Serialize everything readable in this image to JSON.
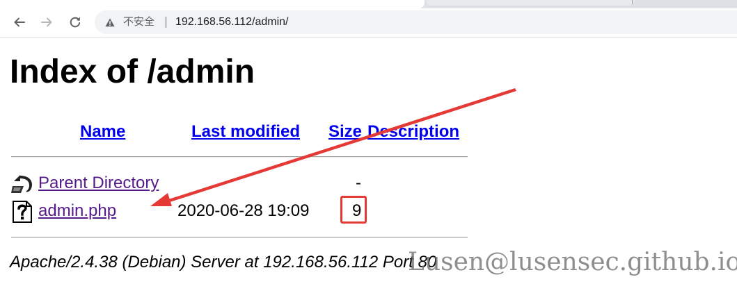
{
  "browser": {
    "security_label": "不安全",
    "url": "192.168.56.112/admin/",
    "icons": {
      "back": "arrow-left-icon",
      "forward": "arrow-right-icon",
      "reload": "reload-icon",
      "security": "warning-triangle-icon"
    }
  },
  "page": {
    "title": "Index of /admin",
    "columns": {
      "name": "Name",
      "last_modified": "Last modified",
      "size": "Size",
      "description": "Description"
    },
    "rows": [
      {
        "icon": "back-arrow-icon",
        "name": "Parent Directory",
        "last_modified": "",
        "size": "-",
        "description": ""
      },
      {
        "icon": "unknown-file-icon",
        "name": "admin.php",
        "last_modified": "2020-06-28 19:09",
        "size": "9",
        "description": ""
      }
    ],
    "footer": "Apache/2.4.38 (Debian) Server at 192.168.56.112 Port 80"
  },
  "annotation": {
    "color": "#e53935",
    "highlight_target": "admin.php size"
  },
  "watermark": "Lusen@lusensec.github.io",
  "colors": {
    "link": "#0000ee",
    "visited_link": "#551a8b",
    "omnibox_bg": "#f1f3f4"
  }
}
